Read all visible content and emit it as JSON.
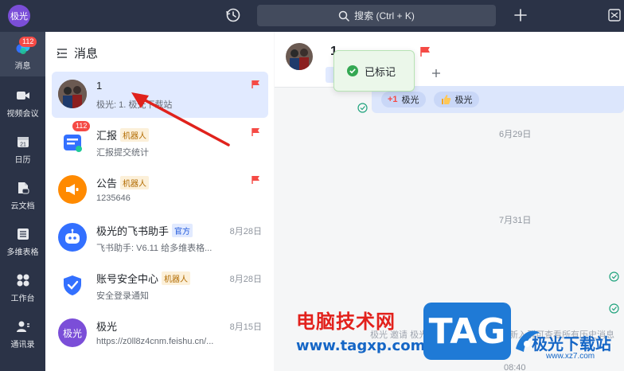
{
  "topbar": {
    "user_avatar_text": "极光",
    "search_label": "搜索 (Ctrl + K)"
  },
  "rail": {
    "items": [
      {
        "label": "消息",
        "badge": "112",
        "icon": "chat-bubble-icon"
      },
      {
        "label": "视频会议",
        "icon": "video-icon"
      },
      {
        "label": "日历",
        "icon": "calendar-icon",
        "icon_text": "21"
      },
      {
        "label": "云文档",
        "icon": "cloud-doc-icon"
      },
      {
        "label": "多维表格",
        "icon": "grid-table-icon"
      },
      {
        "label": "工作台",
        "icon": "apps-icon"
      },
      {
        "label": "通讯录",
        "icon": "contacts-icon"
      }
    ]
  },
  "list": {
    "header": "消息",
    "conversations": [
      {
        "name": "1",
        "preview": "极光: 1. 极光下载站",
        "flagged": true
      },
      {
        "name": "汇报",
        "tag": "机器人",
        "badge": "112",
        "preview": "汇报提交统计",
        "flagged": true
      },
      {
        "name": "公告",
        "tag": "机器人",
        "preview": "1235646",
        "flagged": true
      },
      {
        "name": "极光的飞书助手",
        "tag": "官方",
        "preview": "飞书助手: V6.11 给多维表格...",
        "date": "8月28日"
      },
      {
        "name": "账号安全中心",
        "tag": "机器人",
        "preview": "安全登录通知",
        "date": "8月28日"
      },
      {
        "name": "极光",
        "avatar_text": "极光",
        "preview": "https://z0ll8z4cnm.feishu.cn/...",
        "date": "8月15日"
      }
    ]
  },
  "chat": {
    "title": "1",
    "reactions": [
      {
        "emoji": "+1",
        "user": "极光"
      },
      {
        "emoji": "thumb",
        "user": "极光"
      }
    ],
    "date_separators": [
      "6月29日",
      "7月31日"
    ],
    "bottom_hint_left": "极光 邀请 极光",
    "bottom_hint_right": "新入群可查看所有历史消息",
    "bottom_time": "08:40"
  },
  "toast": {
    "text": "已标记"
  },
  "watermark": {
    "red_text": "电脑技术网",
    "url_text": "www.tagxp.com",
    "tag_text": "TAG",
    "logo_text": "极光下载站",
    "logo_url": "www.xz7.com"
  },
  "colors": {
    "rail_bg": "#2b3347",
    "badge_red": "#f54a45",
    "flag_red": "#f54a45",
    "active_blue": "#e1eaff",
    "toast_green": "#34a853"
  }
}
